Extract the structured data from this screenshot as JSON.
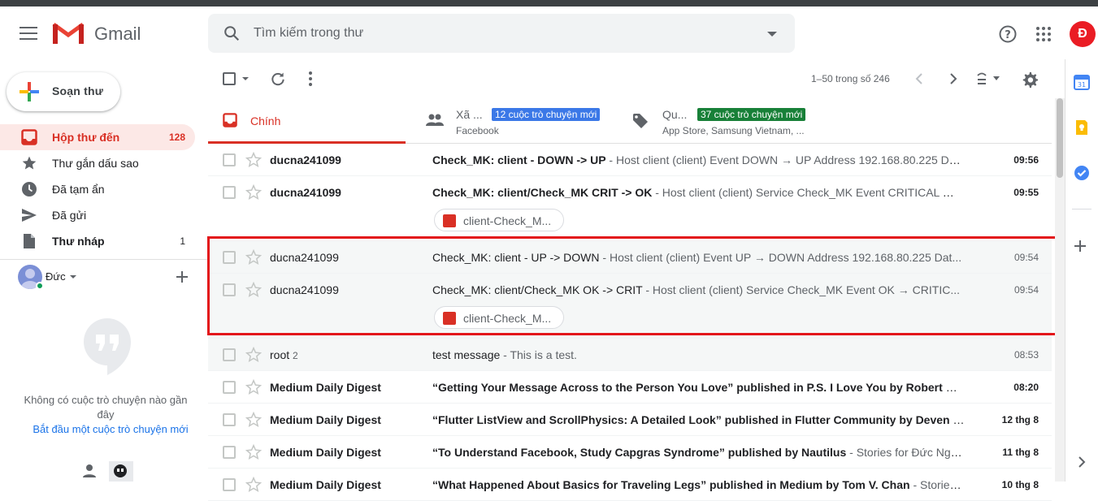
{
  "app": {
    "name": "Gmail",
    "avatar_letter": "Đ"
  },
  "search": {
    "placeholder": "Tìm kiếm trong thư"
  },
  "compose": {
    "label": "Soạn thư"
  },
  "nav": [
    {
      "label": "Hộp thư đến",
      "count": "128",
      "active": true,
      "icon": "inbox-icon"
    },
    {
      "label": "Thư gắn dấu sao",
      "count": "",
      "icon": "star-icon"
    },
    {
      "label": "Đã tạm ẩn",
      "count": "",
      "icon": "clock-icon"
    },
    {
      "label": "Đã gửi",
      "count": "",
      "icon": "send-icon"
    },
    {
      "label": "Thư nháp",
      "count": "1",
      "bold": true,
      "icon": "draft-icon"
    }
  ],
  "hangouts": {
    "user_name": "Đức",
    "empty_text": "Không có cuộc trò chuyện nào gần đây",
    "start_link": "Bắt đầu một cuộc trò chuyện mới"
  },
  "toolbar": {
    "range": "1–50 trong số 246"
  },
  "tabs": {
    "primary": "Chính",
    "social": {
      "name": "Xã ...",
      "badge": "12 cuộc trò chuyện mới",
      "sub": "Facebook"
    },
    "promotions": {
      "name": "Qu...",
      "badge": "37 cuộc trò chuyện mới",
      "sub": "App Store, Samsung Vietnam, ..."
    }
  },
  "emails": [
    {
      "sender": "ducna241099",
      "count": "",
      "subject": "Check_MK: client - DOWN -> UP",
      "snippet": " - Host client (client) Event DOWN → UP Address 192.168.80.225 Da...",
      "time": "09:56",
      "unread": true,
      "attachment": ""
    },
    {
      "sender": "ducna241099",
      "count": "",
      "subject": "Check_MK: client/Check_MK CRIT -> OK",
      "snippet": " - Host client (client) Service Check_MK Event CRITICAL → ...",
      "time": "09:55",
      "unread": true,
      "attachment": "client-Check_M..."
    },
    {
      "sender": "ducna241099",
      "count": "",
      "subject": "Check_MK: client - UP -> DOWN",
      "snippet": " - Host client (client) Event UP → DOWN Address 192.168.80.225 Dat...",
      "time": "09:54",
      "unread": false,
      "attachment": ""
    },
    {
      "sender": "ducna241099",
      "count": "",
      "subject": "Check_MK: client/Check_MK OK -> CRIT",
      "snippet": " - Host client (client) Service Check_MK Event OK → CRITIC...",
      "time": "09:54",
      "unread": false,
      "attachment": "client-Check_M..."
    },
    {
      "sender": "root",
      "count": "2",
      "subject": "test message",
      "snippet": " - This is a test.",
      "time": "08:53",
      "unread": false,
      "attachment": ""
    },
    {
      "sender": "Medium Daily Digest",
      "count": "",
      "subject": "“Getting Your Message Across to the Person You Love” published in P.S. I Love You by Robert Solley",
      "snippet": " - ...",
      "time": "08:20",
      "unread": true,
      "attachment": ""
    },
    {
      "sender": "Medium Daily Digest",
      "count": "",
      "subject": "“Flutter ListView and ScrollPhysics: A Detailed Look” published in Flutter Community by Deven Joshi",
      "snippet": " - ...",
      "time": "12 thg 8",
      "unread": true,
      "attachment": ""
    },
    {
      "sender": "Medium Daily Digest",
      "count": "",
      "subject": "“To Understand Facebook, Study Capgras Syndrome” published by Nautilus",
      "snippet": " - Stories for Đức Nguyễ...",
      "time": "11 thg 8",
      "unread": true,
      "attachment": ""
    },
    {
      "sender": "Medium Daily Digest",
      "count": "",
      "subject": "“What Happened About Basics for Traveling Legs” published in Medium by Tom V. Chan",
      "snippet": " - Stories f...",
      "time": "10 thg 8",
      "unread": true,
      "attachment": ""
    }
  ],
  "colors": {
    "accent": "#d93025",
    "highlight_border": "#e3151a",
    "social_badge": "#3b78e7",
    "promo_badge": "#188038"
  }
}
